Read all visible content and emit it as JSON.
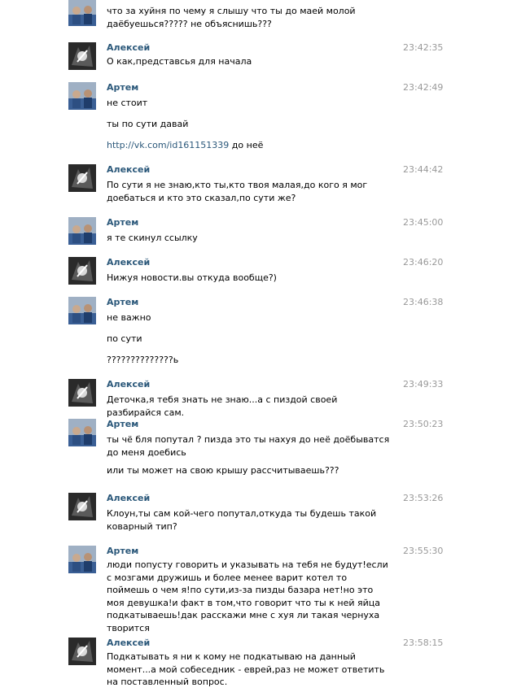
{
  "messages": [
    {
      "author": "",
      "time": "",
      "avatar": "photo",
      "lines": [
        "что за хуйня по чему я слышу что ты до маей молой даёбуешься????? не объяснишь???"
      ]
    },
    {
      "author": "Алексей",
      "time": "23:42:35",
      "avatar": "dark",
      "lines": [
        "О как,представсья для начала"
      ]
    },
    {
      "author": "Артем",
      "time": "23:42:49",
      "avatar": "photo",
      "lines": [
        "не стоит",
        "ты по сути давай"
      ],
      "link": {
        "url": "http://vk.com/id161151339",
        "suffix": " до неё"
      }
    },
    {
      "author": "Алексей",
      "time": "23:44:42",
      "avatar": "dark",
      "lines": [
        "По сути я не знаю,кто ты,кто твоя малая,до кого я мог доебаться и кто это сказал,по сути же?"
      ]
    },
    {
      "author": "Артем",
      "time": "23:45:00",
      "avatar": "photo",
      "lines": [
        "я те скинул ссылку"
      ]
    },
    {
      "author": "Алексей",
      "time": "23:46:20",
      "avatar": "dark",
      "lines": [
        "Нижуя новости.вы откуда вообще?)"
      ]
    },
    {
      "author": "Артем",
      "time": "23:46:38",
      "avatar": "photo",
      "lines": [
        "не важно",
        "по сути",
        "??????????????ь"
      ]
    },
    {
      "author": "Алексей",
      "time": "23:49:33",
      "avatar": "dark",
      "lines": [
        "Деточка,я тебя знать не знаю...а с пиздой своей разбирайся сам."
      ]
    },
    {
      "author": "Артем",
      "time": "23:50:23",
      "avatar": "photo",
      "lines": [
        "ты чё бля попутал ? пизда это ты нахуя до неё доёбыватся до меня доебись",
        "или ты может на свою крышу рассчитываешь???"
      ]
    },
    {
      "author": "Алексей",
      "time": "23:53:26",
      "avatar": "dark",
      "lines": [
        "Клоун,ты сам кой-чего попутал,откуда ты будешь такой коварный тип?"
      ]
    },
    {
      "author": "Артем",
      "time": "23:55:30",
      "avatar": "photo",
      "lines": [
        "люди попусту говорить и указывать на тебя не будут!если с мозгами дружишь и более менее варит котел то поймешь о чем я!по сути,из-за пизды базара нет!но это моя девушка!и факт в том,что говорит что ты к ней яйца подкатываешь!дак расскажи мне с хуя ли такая чернуха творится"
      ]
    },
    {
      "author": "Алексей",
      "time": "23:58:15",
      "avatar": "dark",
      "lines": [
        "Подкатывать я ни к кому не подкатываю на данный момент...а мой собеседник - еврей,раз не может ответить на поставленный вопрос."
      ]
    }
  ]
}
